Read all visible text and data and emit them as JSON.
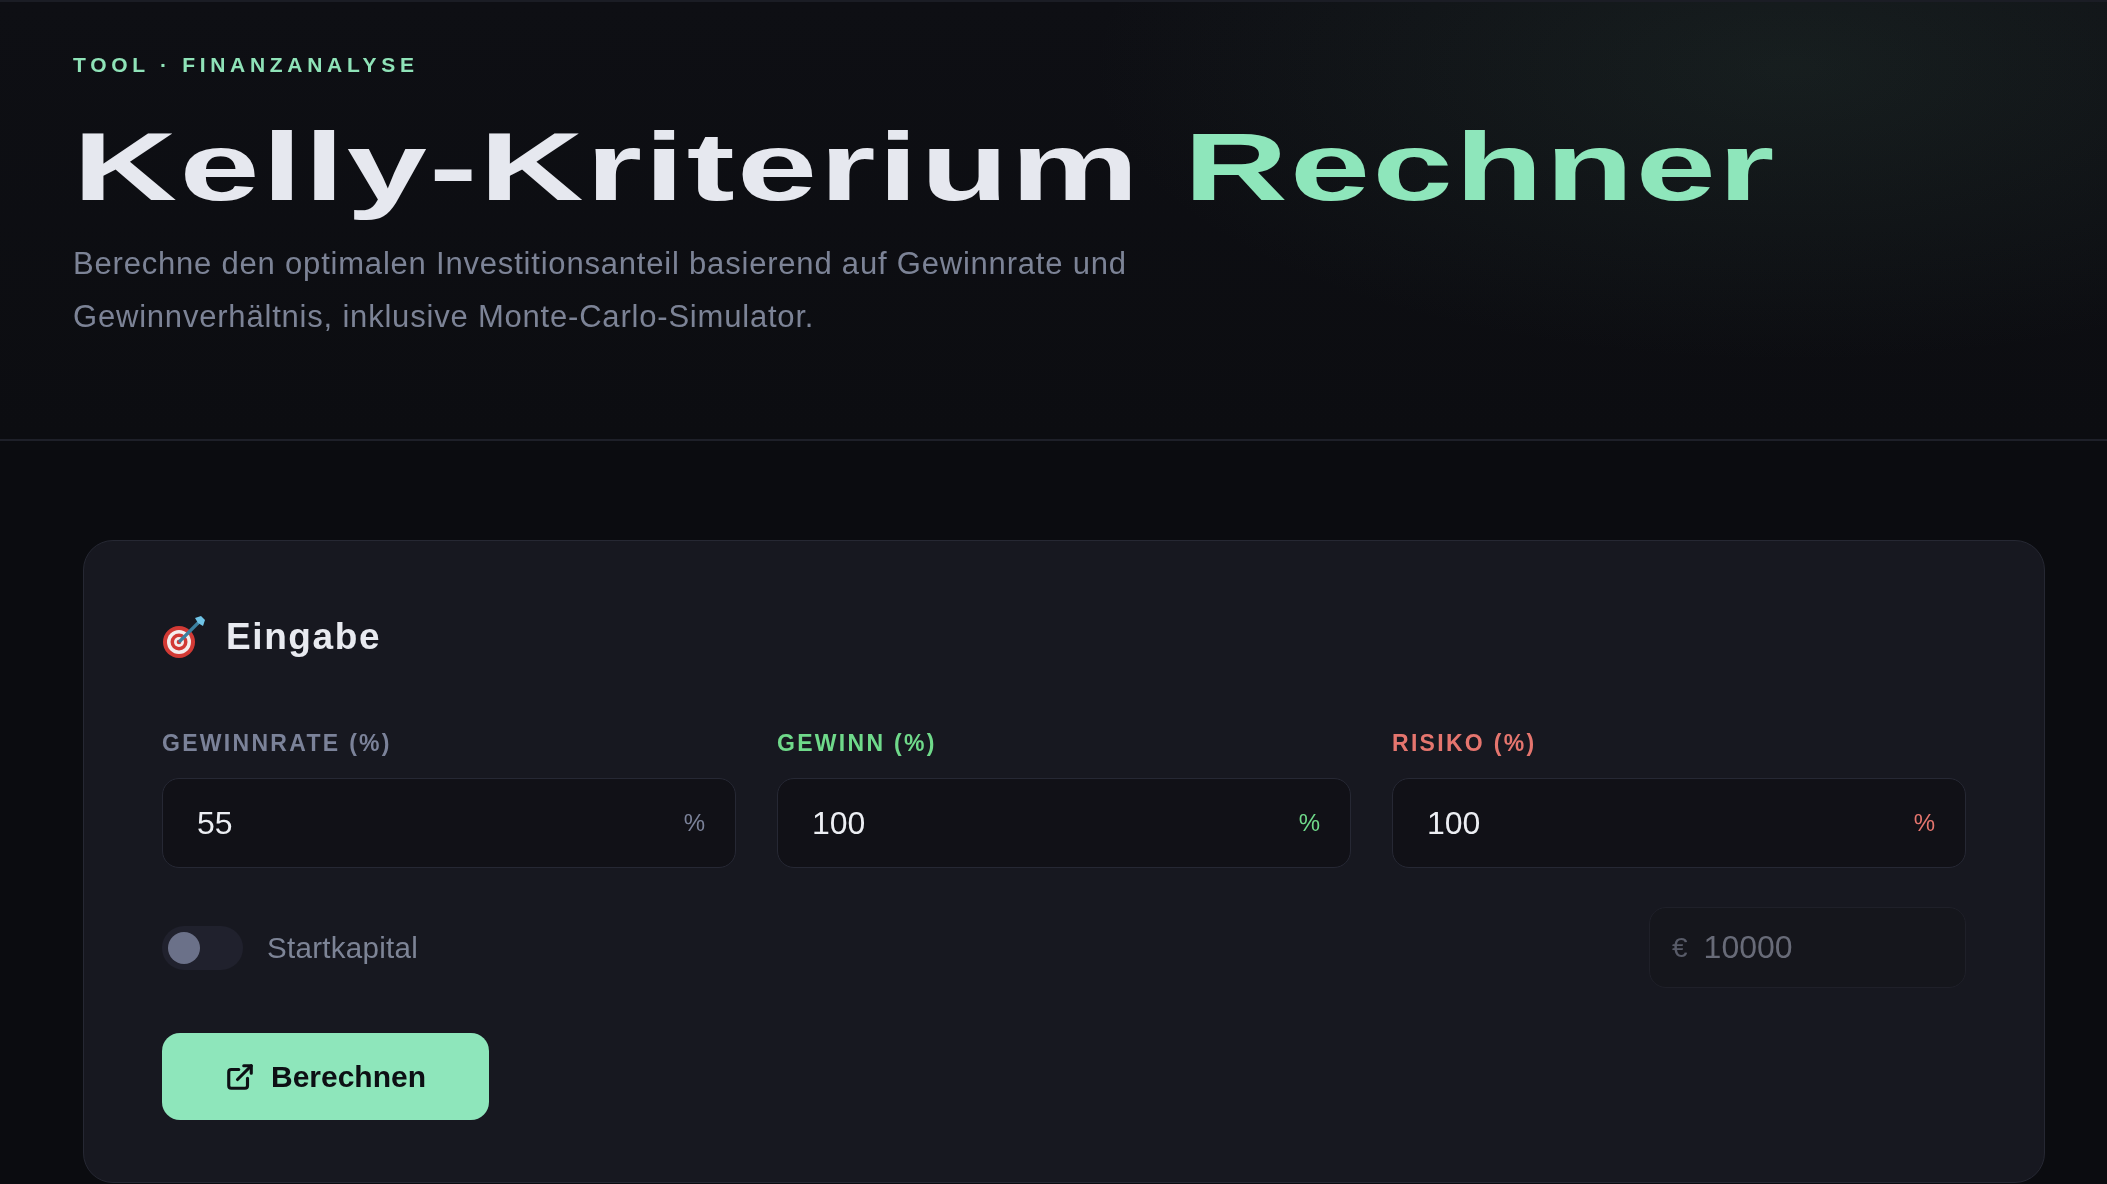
{
  "header": {
    "eyebrow": "TOOL · FINANZANALYSE",
    "title": "Kelly-Kriterium",
    "title_highlight": "Rechner",
    "subtitle": "Berechne den optimalen Investitionsanteil basierend auf Gewinnrate und Gewinnverhältnis, inklusive Monte-Carlo-Simulator."
  },
  "input_card": {
    "title": "Eingabe",
    "fields": [
      {
        "label": "GEWINNRATE (%)",
        "value": "55",
        "suffix": "%",
        "color": "#7b8299"
      },
      {
        "label": "GEWINN (%)",
        "value": "100",
        "suffix": "%",
        "color": "#6fd98a"
      },
      {
        "label": "RISIKO (%)",
        "value": "100",
        "suffix": "%",
        "color": "#e5756e"
      }
    ],
    "capital_toggle": {
      "label": "Startkapital",
      "on": false
    },
    "capital_field": {
      "prefix": "€",
      "value": "10000",
      "disabled": true
    },
    "button": {
      "label": "Berechnen"
    }
  }
}
